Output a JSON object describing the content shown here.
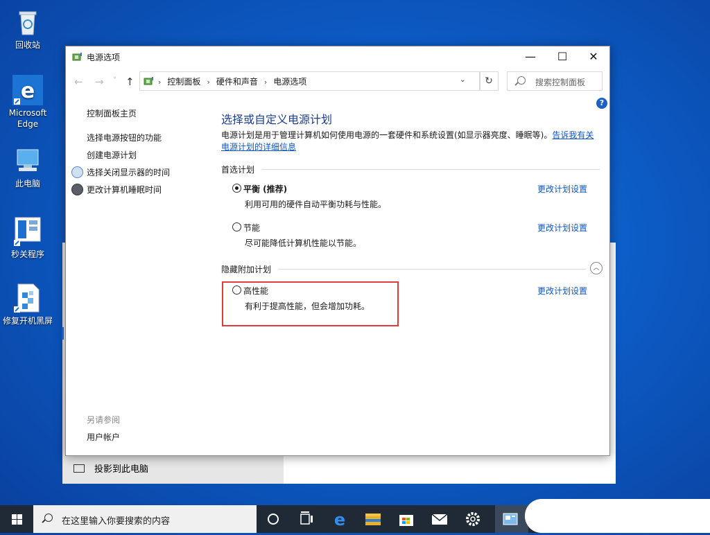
{
  "desktop": {
    "icons": [
      {
        "label": "回收站",
        "icon": "recycle-bin-icon"
      },
      {
        "label": "Microsoft Edge",
        "icon": "edge-icon"
      },
      {
        "label": "此电脑",
        "icon": "this-pc-icon"
      },
      {
        "label": "秒关程序",
        "icon": "shortcut-app-icon"
      },
      {
        "label": "修复开机黑屏",
        "icon": "repair-tool-icon"
      }
    ]
  },
  "background_window": {
    "item_label": "投影到此电脑"
  },
  "window": {
    "title": "电源选项",
    "controls": {
      "minimize": "—",
      "maximize": "☐",
      "close": "✕"
    },
    "nav": {
      "back": "←",
      "forward": "→",
      "recent": "˅",
      "up": "↑"
    },
    "breadcrumb": [
      "控制面板",
      "硬件和声音",
      "电源选项"
    ],
    "breadcrumb_sep": "›",
    "dropdown_glyph": "⌄",
    "refresh_glyph": "↻",
    "search_placeholder": "搜索控制面板",
    "help_glyph": "?",
    "left_nav": {
      "home": "控制面板主页",
      "items": [
        "选择电源按钮的功能",
        "创建电源计划",
        "选择关闭显示器的时间",
        "更改计算机睡眠时间"
      ]
    },
    "see_also": {
      "heading": "另请参阅",
      "items": [
        "用户帐户"
      ]
    },
    "content": {
      "heading": "选择或自定义电源计划",
      "description": "电源计划是用于管理计算机如何使用电源的一套硬件和系统设置(如显示器亮度、睡眠等)。",
      "description_link": "告诉我有关电源计划的详细信息",
      "preferred_group": "首选计划",
      "hidden_group": "隐藏附加计划",
      "collapse_glyph": "︿",
      "change_link": "更改计划设置",
      "plans": [
        {
          "name": "平衡 (推荐)",
          "desc": "利用可用的硬件自动平衡功耗与性能。",
          "selected": true
        },
        {
          "name": "节能",
          "desc": "尽可能降低计算机性能以节能。",
          "selected": false
        },
        {
          "name": "高性能",
          "desc": "有利于提高性能，但会增加功耗。",
          "selected": false
        }
      ]
    }
  },
  "taskbar": {
    "search_placeholder": "在这里输入你要搜索的内容",
    "icons": [
      "cortana-icon",
      "task-view-icon",
      "edge-icon",
      "file-explorer-icon",
      "store-icon",
      "mail-icon",
      "settings-icon",
      "control-panel-icon"
    ]
  },
  "colors": {
    "accent": "#0b57c6",
    "heading": "#1e3e8a",
    "highlight": "#e0393e",
    "taskbar": "#1f2a36"
  }
}
